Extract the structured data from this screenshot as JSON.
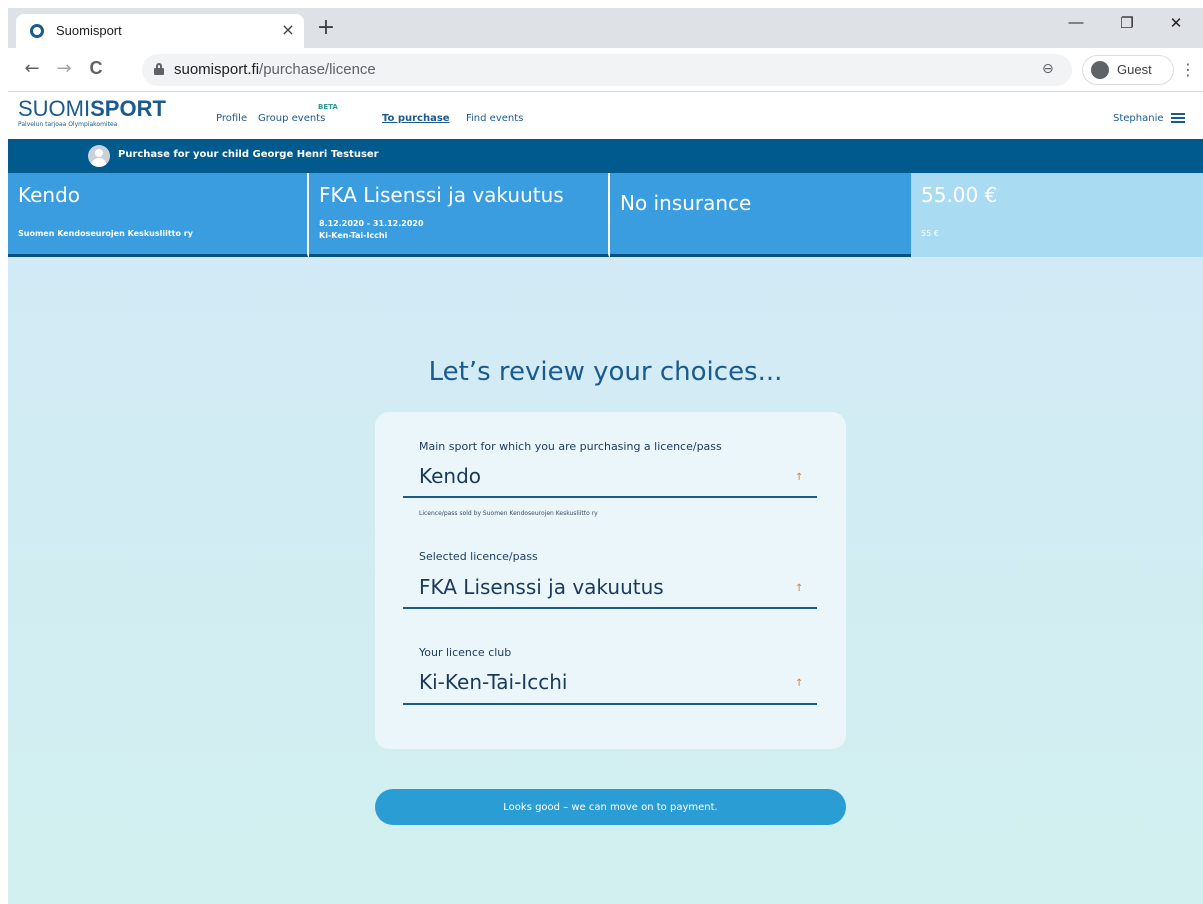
{
  "browser": {
    "tab_title": "Suomisport",
    "tab_close": "×",
    "new_tab": "+",
    "minimize": "—",
    "restore": "❐",
    "close": "✕",
    "back": "←",
    "forward": "→",
    "reload": "C",
    "url_host": "suomisport.fi",
    "url_path": "/purchase/licence",
    "zoom": "⊖",
    "profile_label": "Guest",
    "menu": "⋮"
  },
  "site": {
    "logo_light": "SUOMI",
    "logo_bold": "SPORT",
    "logo_sub": "Palvelun tarjoaa Olympiakomitea",
    "nav": {
      "profile": "Profile",
      "group_events": "Group events",
      "beta": "BETA",
      "to_purchase": "To purchase",
      "find_events": "Find events"
    },
    "user_name": "Stephanie"
  },
  "child_bar": {
    "text": "Purchase for your child George Henri Testuser"
  },
  "summary": {
    "sport": "Kendo",
    "sport_org": "Suomen Kendoseurojen Keskusliitto ry",
    "licence": "FKA Lisenssi ja vakuutus",
    "licence_dates": "8.12.2020 - 31.12.2020",
    "licence_club": "Ki-Ken-Tai-Icchi",
    "insurance": "No insurance",
    "price": "55.00 €",
    "price_sub": "55 €"
  },
  "review": {
    "title": "Let’s review your choices...",
    "sport_label": "Main sport for which you are purchasing a licence/pass",
    "sport_value": "Kendo",
    "sport_hint": "Licence/pass sold by Suomen Kendoseurojen Keskusliitto ry",
    "licence_label": "Selected licence/pass",
    "licence_value": "FKA Lisenssi ja vakuutus",
    "club_label": "Your licence club",
    "club_value": "Ki-Ken-Tai-Icchi",
    "arrow": "↑",
    "cta": "Looks good – we can move on to payment."
  },
  "colors": {
    "brand": "#1a5a8c",
    "bar": "#005a8e",
    "summary_blue": "#3a9de0",
    "price_bg": "#a9dcf2",
    "cta": "#2a9dd5"
  }
}
